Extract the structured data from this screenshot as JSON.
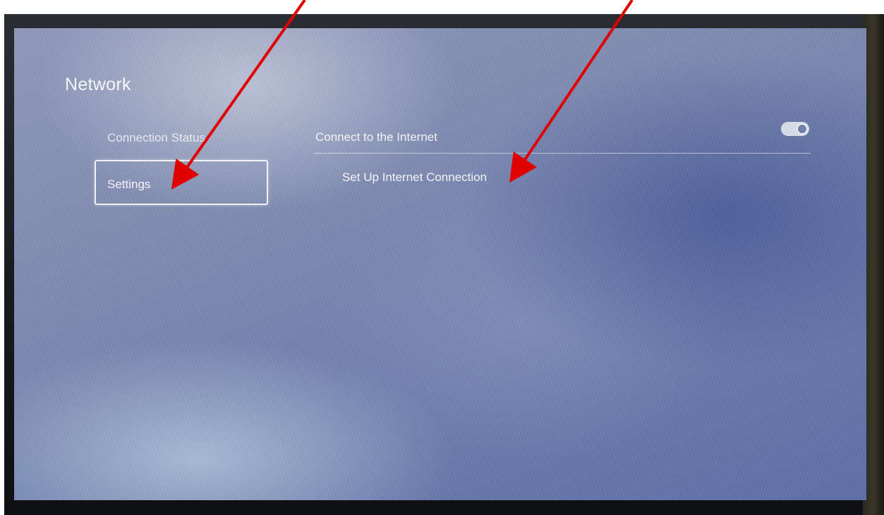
{
  "screen": {
    "title": "Network",
    "nav": {
      "items": [
        {
          "label": "Connection Status"
        },
        {
          "label": "Settings",
          "selected": true
        }
      ]
    },
    "content": {
      "connect_row": {
        "label": "Connect to the Internet",
        "toggle": "on"
      },
      "setup_row": {
        "label": "Set Up Internet Connection"
      }
    }
  },
  "annotations": {
    "arrow_color": "#e00000"
  }
}
